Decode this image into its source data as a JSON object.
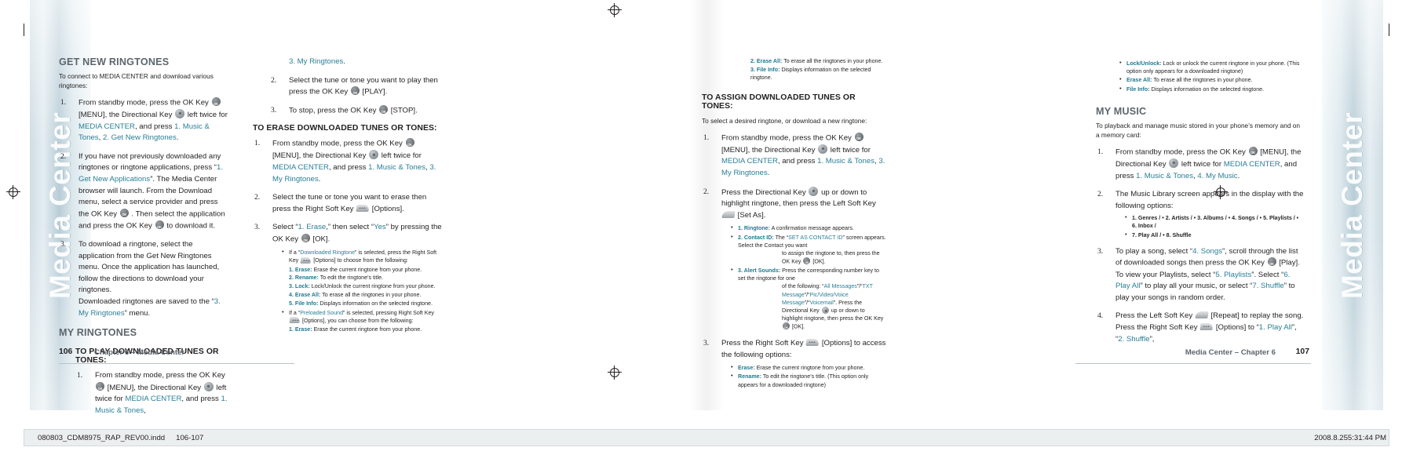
{
  "document": {
    "tab_label_left": "Media Center",
    "tab_label_right": "Media Center"
  },
  "footer": {
    "left_folio": "106",
    "left_chapter": "Chapter 6 – Media Center",
    "right_chapter": "Media Center – Chapter 6",
    "right_folio": "107"
  },
  "slug": {
    "filename": "080803_CDM8975_RAP_REV00.indd",
    "pages": "106-107",
    "date": "2008.8.25",
    "time": "5:31:44 PM"
  },
  "col1": {
    "h_get_new_ringtones": "GET NEW RINGTONES",
    "intro": "To connect to MEDIA CENTER and download various ringtones:",
    "step1": {
      "num": "1.",
      "a": "From standby mode, press the OK Key",
      "b": "[MENU], the Directional Key",
      "c": "left twice for",
      "d": "MEDIA CENTER",
      "e": ", and press",
      "f": "1. Music & Tones",
      "g": ",",
      "h": "2. Get New Ringtones",
      "i": "."
    },
    "step2": {
      "num": "2.",
      "a": "If you have not previously downloaded any ringtones or ringtone applications, press “",
      "b": "1. Get New Applications",
      "c": "”. The Media Center browser will launch. From the Download menu, select a service provider and press the OK Key",
      "d": ". Then select the application and press the OK Key",
      "e": "to download it."
    },
    "step3": {
      "num": "3.",
      "a": "To download a ringtone, select the application from the Get New Ringtones menu. Once the application has launched,",
      "b": "follow the directions to download your ringtones.",
      "c": "Downloaded ringtones are saved to the “",
      "d": "3. My Ringtones",
      "e": "” menu."
    },
    "h_my_ringtones": "MY RINGTONES",
    "h_to_play": "TO PLAY DOWNLOADED TUNES OR TONES:",
    "play_step1": {
      "num": "1.",
      "a": "From standby mode, press the OK Key",
      "b": "[MENU], the Directional Key",
      "c": "left twice for",
      "d": "MEDIA CENTER",
      "e": ", and press",
      "f": "1. Music & Tones",
      "g": ","
    }
  },
  "col2": {
    "cont_link": "3. My Ringtones",
    "cont_period": ".",
    "step2": {
      "num": "2.",
      "a": "Select the tune or tone you want to play then press the OK Key",
      "b": "[PLAY]."
    },
    "step3": {
      "num": "3.",
      "a": "To stop, press the OK Key",
      "b": "[STOP]."
    },
    "h_to_erase": "TO ERASE DOWNLOADED TUNES OR TONES:",
    "erase1": {
      "num": "1.",
      "a": "From standby mode, press the OK Key",
      "b": "[MENU], the Directional Key",
      "c": "left twice for",
      "d": "MEDIA CENTER",
      "e": ", and press",
      "f": "1. Music & Tones",
      "g": ",",
      "h": "3. My Ringtones",
      "i": "."
    },
    "erase2": {
      "num": "2.",
      "a": "Select the tune or tone you want to erase then press the Right Soft Key",
      "b": "[Options]."
    },
    "erase3": {
      "num": "3.",
      "a": "Select “",
      "b": "1. Erase",
      "c": ",” then select “",
      "d": "Yes",
      "e": "” by pressing the OK Key",
      "f": "[OK]."
    },
    "note1": {
      "a": "If a “",
      "b": "Downloaded Ringtone",
      "c": "” is selected, press the Right Soft Key",
      "d": "[Options] to choose from the following:"
    },
    "note1_items": [
      {
        "label": "1. Erase:",
        "text": "Erase the current ringtone from your phone."
      },
      {
        "label": "2. Rename:",
        "text": "To edit the ringtone’s title."
      },
      {
        "label": "3. Lock:",
        "text": "Lock/Unlock the current ringtone from your phone."
      },
      {
        "label": "4. Erase All:",
        "text": "To erase all the ringtones in your phone."
      },
      {
        "label": "5. File Info:",
        "text": "Displays information on the selected ringtone."
      }
    ],
    "note2": {
      "a": "If a “",
      "b": "Preloaded Sound",
      "c": "” is selected, pressing Right Soft Key",
      "d": "[Options], you can choose from the following:"
    },
    "note2_items": [
      {
        "label": "1. Erase:",
        "text": "Erase the current ringtone from your phone."
      }
    ]
  },
  "col3": {
    "cont_items": [
      {
        "label": "2. Erase All:",
        "text": "To erase all the ringtones in your phone."
      },
      {
        "label": "3. File Info:",
        "text": "Displays information on the selected ringtone."
      }
    ],
    "h_to_assign": "TO ASSIGN DOWNLOADED TUNES OR TONES:",
    "intro": "To select a desired ringtone, or download a new ringtone:",
    "step1": {
      "num": "1.",
      "a": "From standby mode, press the OK Key",
      "b": "[MENU], the Directional Key",
      "c": "left twice for",
      "d": "MEDIA CENTER",
      "e": ", and press",
      "f": "1. Music & Tones",
      "g": ",",
      "h": "3. My Ringtones",
      "i": "."
    },
    "step2": {
      "num": "2.",
      "a": "Press the Directional Key",
      "b": "up or down to highlight ringtone, then press the Left Soft Key",
      "c": "[Set As]."
    },
    "step2_notes": [
      {
        "label": "1. Ringtone:",
        "text": "A confirmation message appears."
      }
    ],
    "contact_id": {
      "label": "2. Contact ID:",
      "a": "The “",
      "b": "SET AS CONTACT ID",
      "c": "” screen appears. Select the Contact you want",
      "d": "to assign the ringtone to, then press the OK Key",
      "e": "[OK]."
    },
    "alert_sounds": {
      "label": "3. Alert Sounds:",
      "a": "Press the corresponding number key to set the ringtone for one",
      "b": "of the following: “",
      "c": "All Messages",
      "d": "”/“",
      "e": "TXT Message",
      "f": "”/“",
      "g": "Pic/Video/Voice Message",
      "h": "”/“",
      "i": "Voicemail",
      "j": "”. Press the Directional Key",
      "k": "up or down to highlight ringtone, then press the OK Key",
      "l": "[OK]."
    },
    "step3": {
      "num": "3.",
      "a": "Press the Right Soft Key",
      "b": "[Options] to access the following options:"
    },
    "step3_items": [
      {
        "label": "Erase:",
        "text": "Erase the current ringtone from your phone."
      },
      {
        "label": "Rename:",
        "text": "To edit the ringtone’s title. (This option only appears for a downloaded ringtone)"
      }
    ]
  },
  "col4": {
    "cont_items": [
      {
        "label": "Lock/Unlock:",
        "text": "Lock or unlock the current ringtone in your phone. (This option only appears for a downloaded ringtone)"
      },
      {
        "label": "Erase All:",
        "text": "To erase all the ringtones in your phone."
      },
      {
        "label": "File Info:",
        "text": "Displays information on the selected ringtone."
      }
    ],
    "h_my_music": "MY MUSIC",
    "intro": "To playback and manage music stored in your phone’s memory and on a memory card:",
    "step1": {
      "num": "1.",
      "a": "From standby mode, press the OK Key",
      "b": "[MENU], the Directional Key",
      "c": "left twice for",
      "d": "MEDIA CENTER",
      "e": ", and press",
      "f": "1. Music & Tones",
      "g": ",",
      "h": "4. My Music",
      "i": "."
    },
    "step2": {
      "num": "2.",
      "a": "The Music Library screen appears in the display with the following options:"
    },
    "step2_options_line1": "1. Genres /  •  2. Artists /  •  3. Albums /  •  4. Songs /  •  5. Playlists /  •  6. Inbox /",
    "step2_options_line2": "7. Play All /  •  8. Shuffle",
    "step3": {
      "num": "3.",
      "a": "To play a song, select “",
      "b": "4. Songs",
      "c": "”, scroll through the list of downloaded songs then press the OK Key",
      "d": "[Play]. To view your Playlists, select “",
      "e": "5. Playlists",
      "f": "”. Select “",
      "g": "6. Play All",
      "h": "” to play all your music, or select “",
      "i": "7. Shuffle",
      "j": "” to play your songs in random order."
    },
    "step4": {
      "num": "4.",
      "a": "Press the Left Soft Key",
      "b": "[Repeat] to replay the song. Press the Right Soft Key",
      "c": "[Options] to “",
      "d": "1. Play All",
      "e": "”, “",
      "f": "2. Shuffle",
      "g": "”,"
    }
  },
  "colors": {
    "teal": "#2a7f96",
    "heading_gray": "#5d666d",
    "body": "#231f20"
  }
}
